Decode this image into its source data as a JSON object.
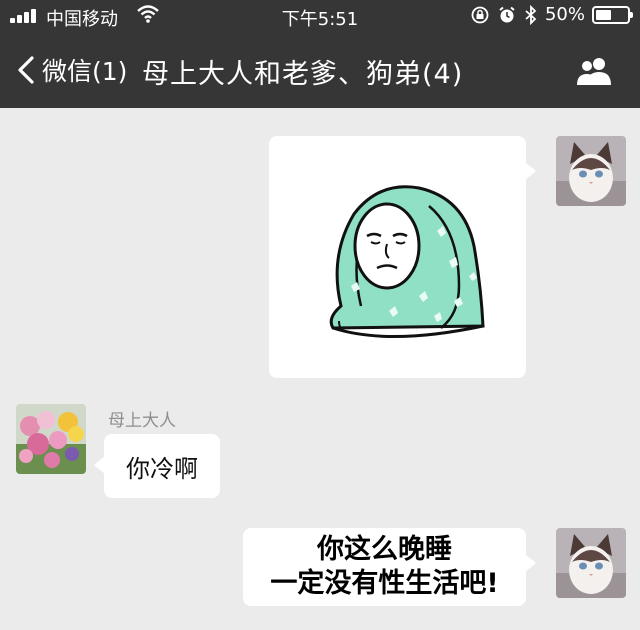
{
  "status_bar": {
    "carrier": "中国移动",
    "time": "下午5:51",
    "battery": "50%",
    "battery_level": 0.5,
    "icons": [
      "signal-icon",
      "wifi-icon",
      "orientation-lock-icon",
      "alarm-icon",
      "bluetooth-icon",
      "battery-icon"
    ]
  },
  "nav": {
    "back_label": "微信(1)",
    "title": "母上大人和老爹、狗弟(4)",
    "right_icon": "group-members-icon"
  },
  "messages": [
    {
      "side": "right",
      "type": "sticker",
      "avatar": "cat-avatar",
      "sticker": "blanket-wrapped-face-sticker"
    },
    {
      "side": "left",
      "type": "text",
      "avatar": "flower-avatar",
      "sender": "母上大人",
      "text": "你冷啊"
    },
    {
      "side": "right",
      "type": "meme-text",
      "avatar": "cat-avatar",
      "line1": "你这么晚睡",
      "line2": "一定没有性生活吧!"
    }
  ],
  "colors": {
    "nav_bg": "#363636",
    "chat_bg": "#ebebeb",
    "bubble_bg": "#ffffff",
    "sender_name": "#8f8f8f"
  }
}
